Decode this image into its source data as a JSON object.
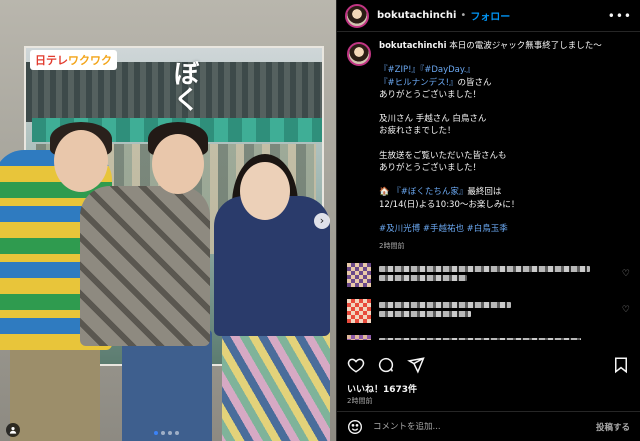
{
  "photo": {
    "logo_main": "日テレ",
    "logo_sub": "ワクワク",
    "poster_title": "ぼく"
  },
  "header": {
    "username": "bokutachinchi",
    "separator": "•",
    "follow_label": "フォロー",
    "more_label": "•••"
  },
  "caption": {
    "username": "bokutachinchi",
    "lead": " 本日の電波ジャック無事終了しました〜",
    "line_tags_1": "『#ZIP!』『#DayDay.』",
    "line_tags_2": "『#ヒルナンデス!』",
    "line_tags_2b": "の皆さん",
    "line_thanks": "ありがとうございました！",
    "line_cast": "及川さん 手越さん 白鳥さん",
    "line_tired": "お疲れさまでした！",
    "line_viewers": "生放送をご覧いただいた皆さんも",
    "line_thanks2": "ありがとうございました！",
    "house_emoji": "🏠",
    "house_tag": "『#ぼくたちん家』",
    "house_text": "最終回は",
    "air_line": "12/14(日)よる10:30〜お楽しみに！",
    "hashtags": "#及川光博 #手越祐也 #白鳥玉季",
    "time": "2時間前"
  },
  "post": {
    "likes": "いいね！1673件",
    "time": "2時間前"
  },
  "comment_box": {
    "placeholder": "コメントを追加...",
    "post_label": "投稿する"
  },
  "icons": {
    "like": "heart-icon",
    "comment": "comment-icon",
    "share": "send-icon",
    "save": "bookmark-icon",
    "emoji": "emoji-icon",
    "next": "chevron-right-icon",
    "tag": "user-tag-icon"
  },
  "colors": {
    "accent": "#0095f6",
    "hashtag": "#6aa7f0",
    "background": "#000000"
  }
}
